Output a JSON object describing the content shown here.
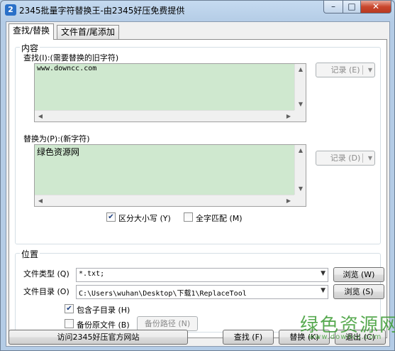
{
  "window": {
    "title": "2345批量字符替换王-由2345好压免费提供",
    "icon_label": "2",
    "minimize_glyph": "–",
    "maximize_glyph": "□",
    "close_glyph": "✕"
  },
  "tabs": [
    {
      "label": "查找/替换",
      "active": true
    },
    {
      "label": "文件首/尾添加",
      "active": false
    }
  ],
  "content": {
    "group_title": "内容",
    "find_label": "查找(I):(需要替换的旧字符)",
    "find_value": "www.downcc.com",
    "find_record_button": "记录 (E)",
    "replace_label": "替换为(P):(新字符)",
    "replace_value": "绿色资源网",
    "replace_record_button": "记录 (D)",
    "case_sensitive_label": "区分大小写 (Y)",
    "case_sensitive_checked": true,
    "full_match_label": "全字匹配 (M)",
    "full_match_checked": false
  },
  "location": {
    "group_title": "位置",
    "file_type_label": "文件类型 (Q)",
    "file_type_value": "*.txt;",
    "browse_type_button": "浏览 (W)",
    "file_dir_label": "文件目录 (O)",
    "file_dir_value": "C:\\Users\\wuhan\\Desktop\\下载1\\ReplaceTool",
    "browse_dir_button": "浏览 (S)",
    "include_subdirs_label": "包含子目录 (H)",
    "include_subdirs_checked": true,
    "backup_label": "备份原文件 (B)",
    "backup_checked": false,
    "backup_path_button": "备份路径 (N)"
  },
  "footer": {
    "visit_site_button": "访问2345好压官方网站",
    "find_button": "查找 (F)",
    "replace_button": "替换 (K)",
    "exit_button": "退出 (C)"
  },
  "watermark": {
    "main": "绿色资源网",
    "sub": "www.downcc.com"
  },
  "colors": {
    "textarea_bg": "#cfe8cf",
    "watermark": "#3c9c33",
    "close_button": "#c9462c"
  }
}
